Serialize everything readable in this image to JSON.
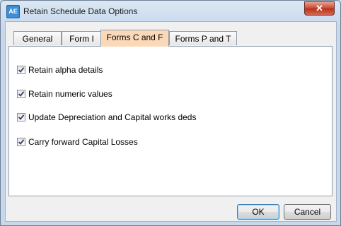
{
  "window": {
    "app_icon": "AE",
    "title": "Retain Schedule Data Options",
    "close_glyph": "✕"
  },
  "tabs": [
    {
      "label": "General",
      "active": false
    },
    {
      "label": "Form I",
      "active": false
    },
    {
      "label": "Forms C and F",
      "active": true
    },
    {
      "label": "Forms P and T",
      "active": false
    }
  ],
  "options": [
    {
      "label": "Retain alpha details",
      "checked": true
    },
    {
      "label": "Retain numeric values",
      "checked": true
    },
    {
      "label": "Update Depreciation and Capital works deds",
      "checked": true
    },
    {
      "label": "Carry forward Capital Losses",
      "checked": true
    }
  ],
  "buttons": {
    "ok": "OK",
    "cancel": "Cancel"
  }
}
